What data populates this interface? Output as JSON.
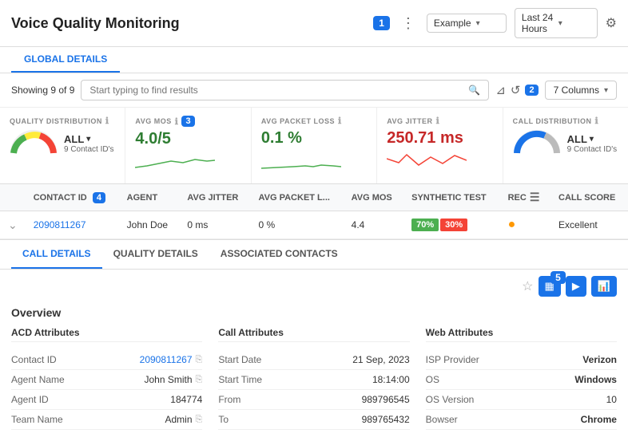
{
  "header": {
    "title": "Voice Quality Monitoring",
    "badge1": "1",
    "example_label": "Example",
    "time_range": "Last 24 Hours"
  },
  "toolbar": {
    "showing_text": "Showing 9 of 9",
    "search_placeholder": "Start typing to find results",
    "badge2": "2",
    "columns_label": "7 Columns"
  },
  "metrics": [
    {
      "label": "QUALITY DISTRIBUTION",
      "type": "gauge",
      "value": "ALL",
      "sub": "9 Contact ID's"
    },
    {
      "label": "AVG MOS",
      "type": "value",
      "value": "4.0/5",
      "badge": "3"
    },
    {
      "label": "AVG PACKET LOSS",
      "type": "sparkline",
      "value": "0.1 %"
    },
    {
      "label": "AVG JITTER",
      "type": "value",
      "value": "250.71 ms",
      "value_class": "red"
    },
    {
      "label": "CALL DISTRIBUTION",
      "type": "gauge",
      "value": "ALL",
      "sub": "9 Contact ID's"
    }
  ],
  "table": {
    "headers": [
      "CONTACT ID",
      "AGENT",
      "AVG JITTER",
      "AVG PACKET L...",
      "AVG MOS",
      "SYNTHETIC TEST",
      "REC",
      "CALL SCORE"
    ],
    "row": {
      "contact_id": "2090811267",
      "agent": "John Doe",
      "avg_jitter": "0 ms",
      "avg_packet_loss": "0 %",
      "avg_mos": "4.4",
      "synthetic_green": "70%",
      "synthetic_red": "30%",
      "call_score": "Excellent",
      "badge4": "4"
    }
  },
  "detail_tabs": [
    "CALL DETAILS",
    "QUALITY DETAILS",
    "ASSOCIATED CONTACTS"
  ],
  "detail": {
    "overview_title": "Overview",
    "badge5": "5",
    "acd": {
      "title": "ACD Attributes",
      "fields": [
        {
          "label": "Contact ID",
          "value": "2090811267",
          "is_link": true,
          "copyable": true
        },
        {
          "label": "Agent Name",
          "value": "John Smith",
          "copyable": true
        },
        {
          "label": "Agent ID",
          "value": "184774",
          "copyable": false
        },
        {
          "label": "Team Name",
          "value": "Admin",
          "copyable": true
        }
      ]
    },
    "call": {
      "title": "Call Attributes",
      "fields": [
        {
          "label": "Start Date",
          "value": "21 Sep, 2023"
        },
        {
          "label": "Start Time",
          "value": "18:14:00"
        },
        {
          "label": "From",
          "value": "989796545"
        },
        {
          "label": "To",
          "value": "989765432"
        }
      ]
    },
    "web": {
      "title": "Web  Attributes",
      "fields": [
        {
          "label": "ISP Provider",
          "value": "Verizon",
          "bold": true
        },
        {
          "label": "OS",
          "value": "Windows",
          "bold": true
        },
        {
          "label": "OS Version",
          "value": "10"
        },
        {
          "label": "Bowser",
          "value": "Chrome",
          "bold": true
        }
      ]
    }
  }
}
